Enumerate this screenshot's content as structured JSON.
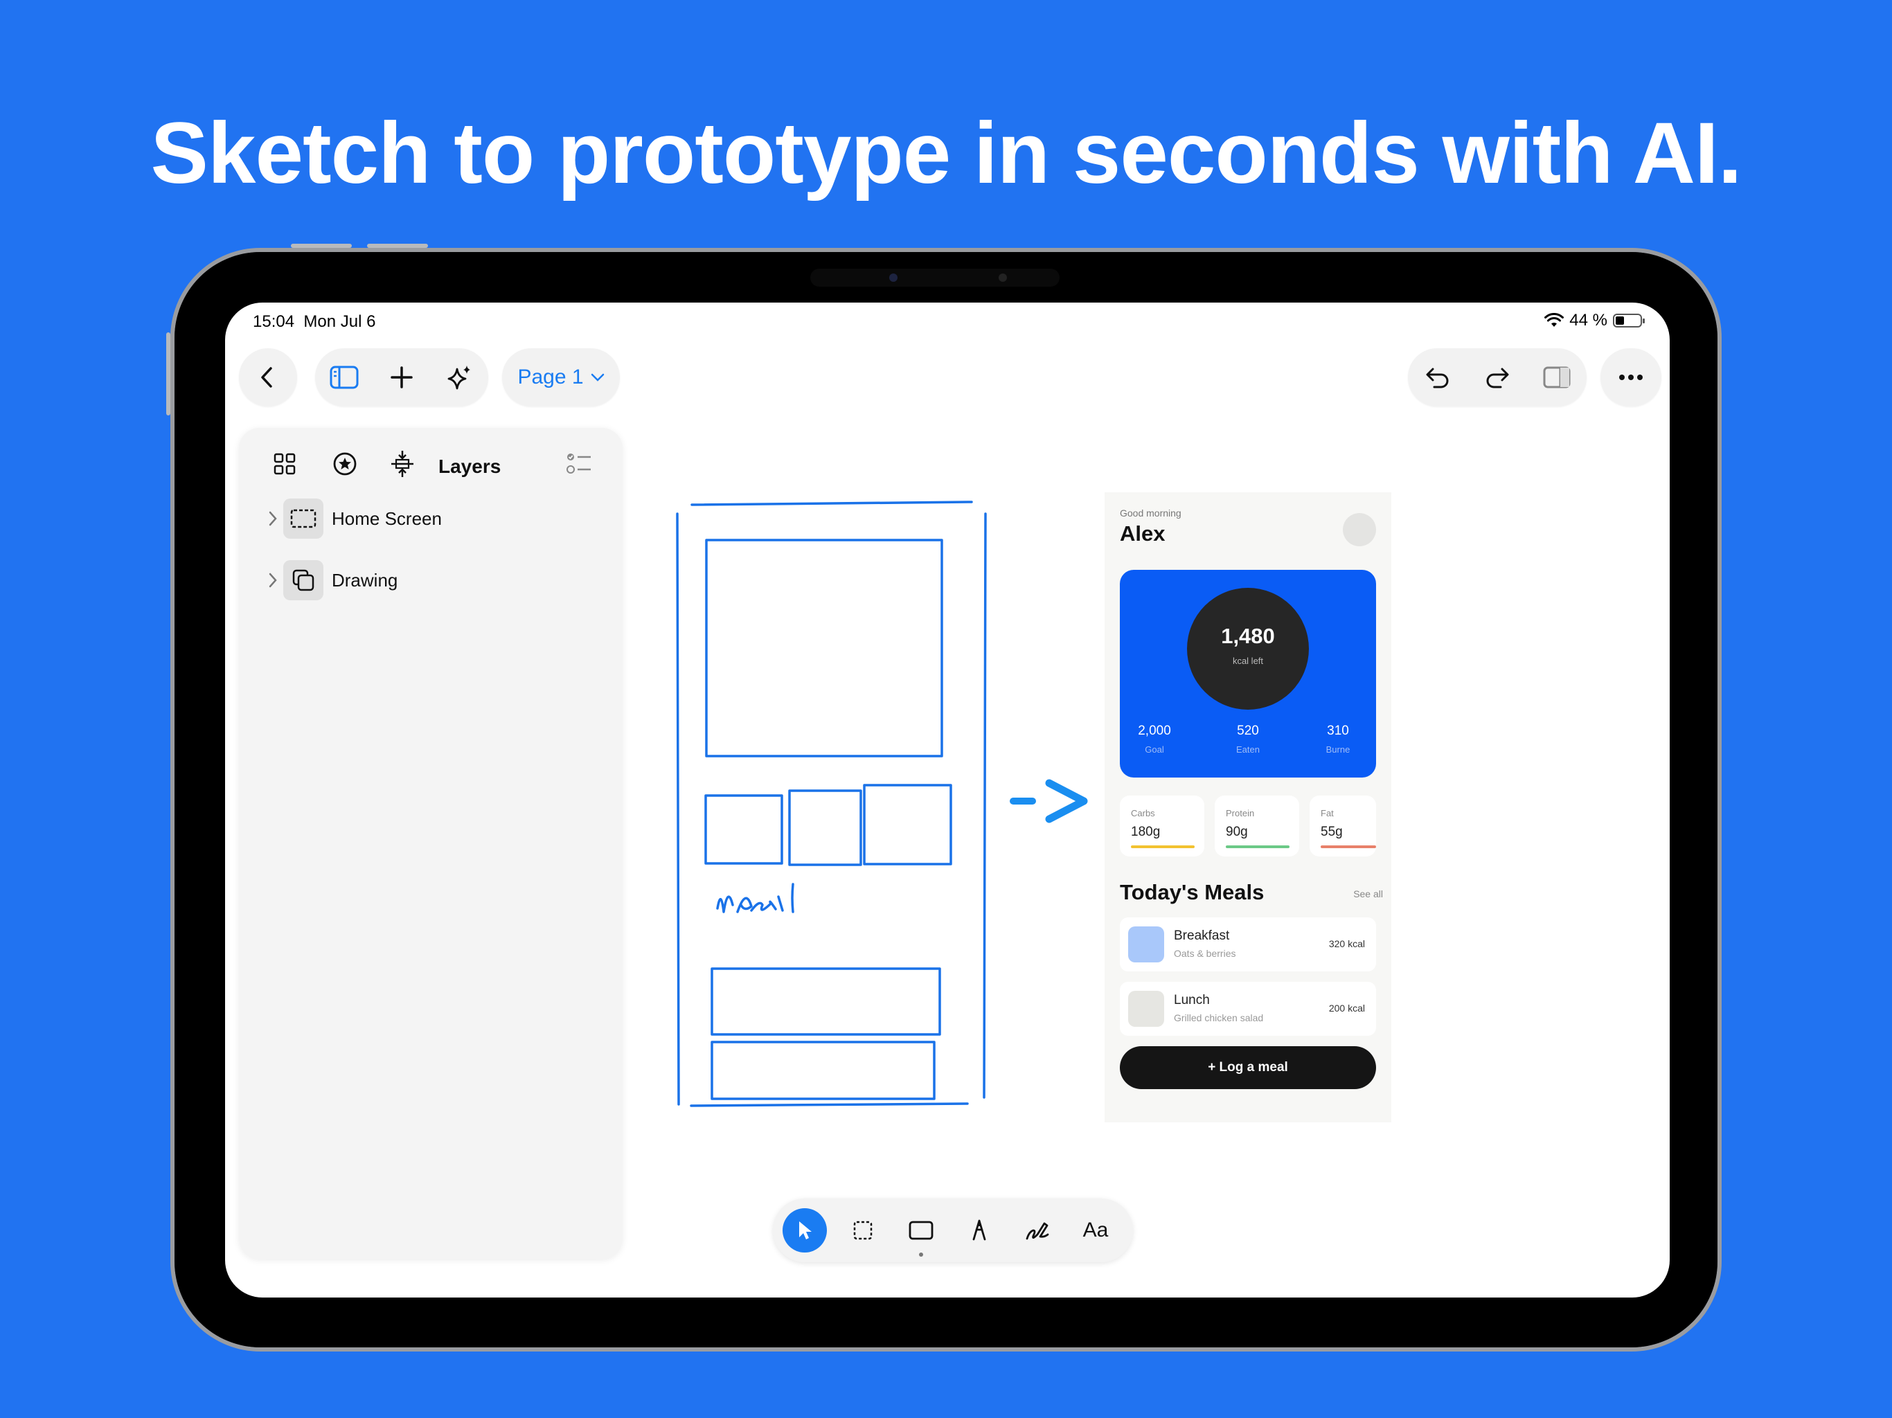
{
  "headline": "Sketch to prototype in seconds with AI.",
  "status_bar": {
    "time": "15:04",
    "date": "Mon Jul 6",
    "battery": "44 %"
  },
  "top_toolbar": {
    "page_label": "Page 1",
    "left_icons": [
      "back-chevron-icon",
      "sidebar-icon",
      "plus-icon",
      "sparkles-icon"
    ],
    "right_icons": [
      "undo-icon",
      "redo-icon",
      "inspector-panel-icon",
      "more-icon"
    ]
  },
  "layers_panel": {
    "title": "Layers",
    "tab_icons": [
      "grid-icon",
      "star-icon",
      "align-icon",
      "checklist-icon"
    ],
    "items": [
      {
        "label": "Home Screen",
        "icon": "frame-icon"
      },
      {
        "label": "Drawing",
        "icon": "group-icon"
      }
    ]
  },
  "sketch": {
    "handwritten": "Meal"
  },
  "arrow_text": "->",
  "prototype": {
    "greeting": "Good morning",
    "name": "Alex",
    "kcal_value": "1,480",
    "kcal_label": "kcal left",
    "stats": [
      {
        "value": "2,000",
        "label": "Goal"
      },
      {
        "value": "520",
        "label": "Eaten"
      },
      {
        "value": "310",
        "label": "Burne"
      }
    ],
    "macros": [
      {
        "label": "Carbs",
        "value": "180g",
        "color": "#F2C230"
      },
      {
        "label": "Protein",
        "value": "90g",
        "color": "#6CC987"
      },
      {
        "label": "Fat",
        "value": "55g",
        "color": "#E8806A"
      }
    ],
    "section_title": "Today's Meals",
    "see_all": "See all",
    "meals": [
      {
        "name": "Breakfast",
        "sub": "Oats & berries",
        "kcal": "320 kcal",
        "color": "#A9C8FA"
      },
      {
        "name": "Lunch",
        "sub": "Grilled chicken salad",
        "kcal": "200 kcal",
        "color": "#E6E6E2"
      }
    ],
    "cta": "+ Log a meal"
  },
  "bottom_toolbar": {
    "tools": [
      "pointer-icon",
      "marquee-icon",
      "rectangle-icon",
      "pen-icon",
      "pencil-icon",
      "text-tool"
    ],
    "text_tool_label": "Aa"
  },
  "colors": {
    "background": "#2173F1",
    "accent": "#1A7CF2",
    "sketch_stroke": "#1A72E8",
    "card_blue": "#0A5CF5"
  }
}
